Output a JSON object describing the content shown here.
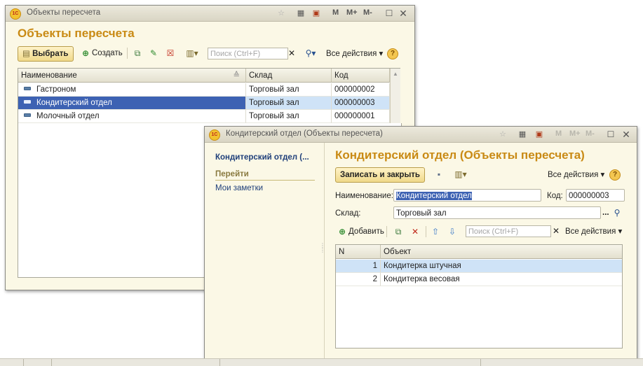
{
  "back_window": {
    "title": "Объекты пересчета",
    "heading": "Объекты пересчета",
    "toolbar": {
      "select_label": "Выбрать",
      "create_label": "Создать",
      "search_placeholder": "Поиск (Ctrl+F)",
      "all_actions": "Все действия ▾",
      "help": "?"
    },
    "title_m": "M",
    "title_mplus": "M+",
    "title_mminus": "M-",
    "columns": [
      "Наименование",
      "Склад",
      "Код"
    ],
    "rows": [
      {
        "name": "Гастроном",
        "warehouse": "Торговый зал",
        "code": "000000002"
      },
      {
        "name": "Кондитерский отдел",
        "warehouse": "Торговый зал",
        "code": "000000003"
      },
      {
        "name": "Молочный отдел",
        "warehouse": "Торговый зал",
        "code": "000000001"
      }
    ],
    "selected_row": 1
  },
  "front_window": {
    "title": "Кондитерский отдел (Объекты пересчета)",
    "heading": "Кондитерский отдел (Объекты пересчета)",
    "nav": {
      "current": "Кондитерский отдел (...",
      "section": "Перейти",
      "links": [
        "Мои заметки"
      ]
    },
    "toolbar": {
      "save_close": "Записать и закрыть",
      "all_actions": "Все действия ▾",
      "help": "?"
    },
    "form": {
      "name_label": "Наименование:",
      "name_value": "Кондитерский отдел",
      "code_label": "Код:",
      "code_value": "000000003",
      "warehouse_label": "Склад:",
      "warehouse_value": "Торговый зал",
      "ellipsis": "..."
    },
    "table_toolbar": {
      "add_label": "Добавить",
      "search_placeholder": "Поиск (Ctrl+F)",
      "all_actions": "Все действия ▾"
    },
    "table": {
      "columns": [
        "N",
        "Объект"
      ],
      "rows": [
        {
          "n": "1",
          "object": "Кондитерка штучная"
        },
        {
          "n": "2",
          "object": "Кондитерка весовая"
        }
      ],
      "selected_row": 0
    }
  },
  "colors": {
    "accent": "#c98a14",
    "selection_dark": "#3d62b3",
    "selection_light": "#cfe3f7",
    "window_bg": "#fbf8e6"
  }
}
